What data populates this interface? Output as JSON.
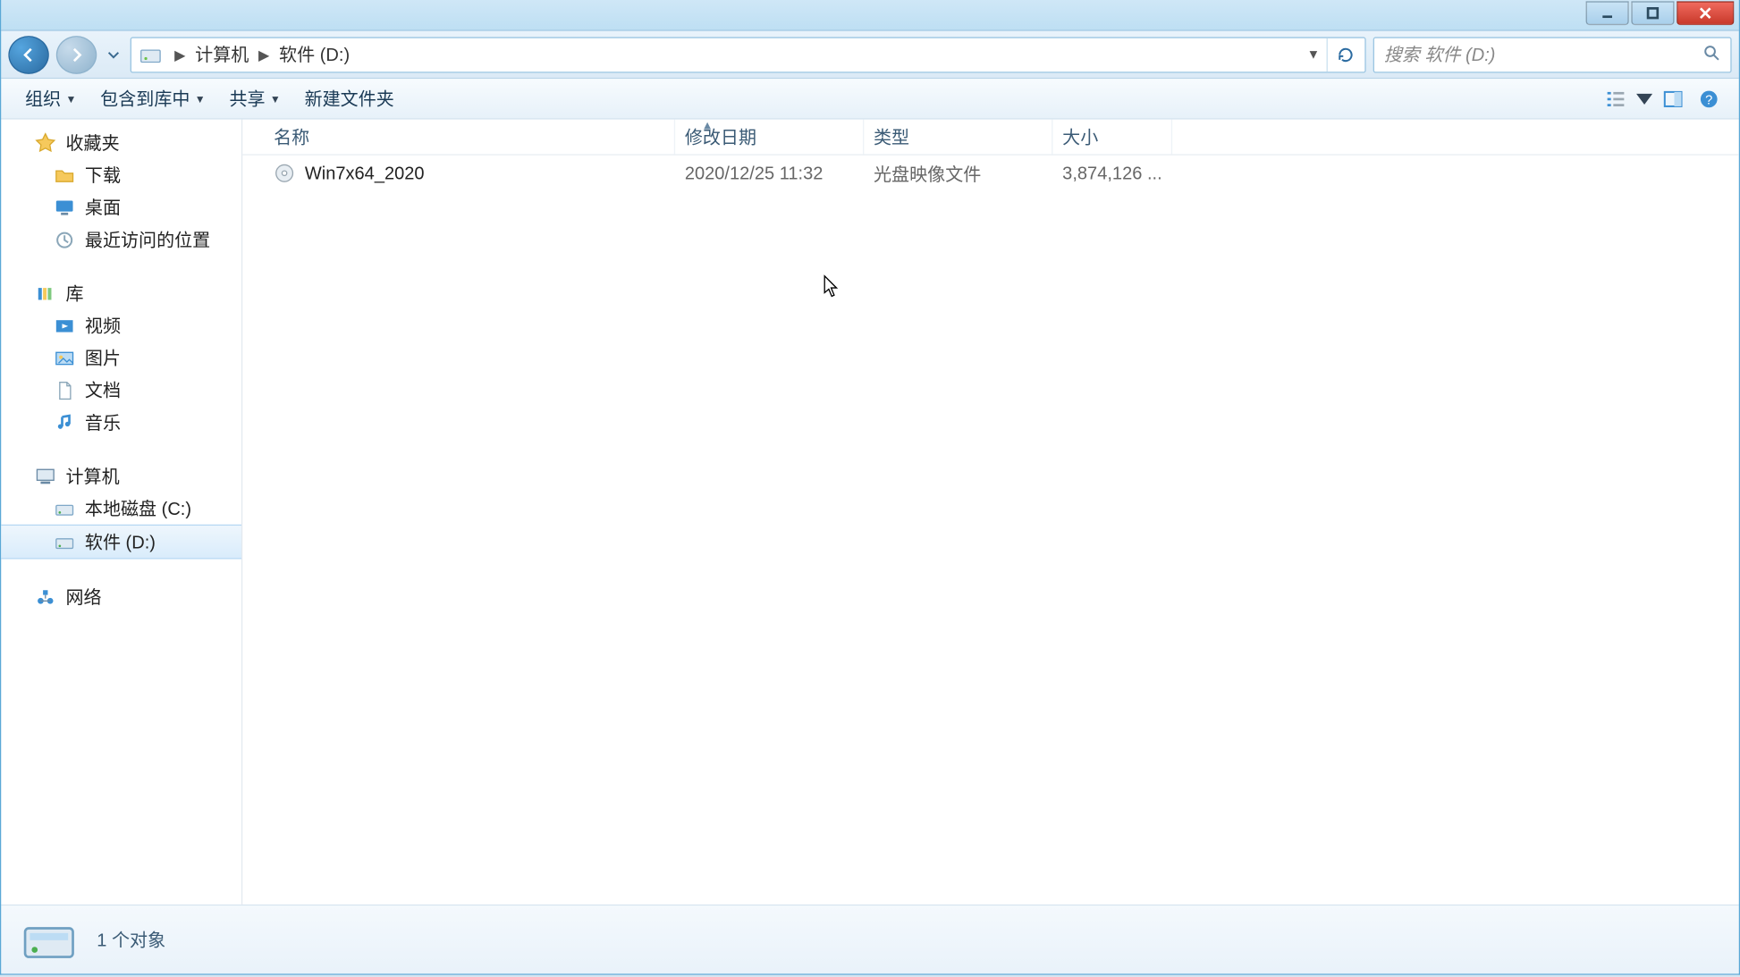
{
  "breadcrumbs": {
    "computer": "计算机",
    "drive": "软件 (D:)"
  },
  "search_placeholder": "搜索 软件 (D:)",
  "toolbar": {
    "organize": "组织",
    "include": "包含到库中",
    "share": "共享",
    "newfolder": "新建文件夹"
  },
  "columns": {
    "name": "名称",
    "date": "修改日期",
    "type": "类型",
    "size": "大小"
  },
  "files": [
    {
      "name": "Win7x64_2020",
      "date": "2020/12/25 11:32",
      "type": "光盘映像文件",
      "size": "3,874,126 ..."
    }
  ],
  "sidebar": {
    "fav": {
      "head": "收藏夹",
      "items": [
        "下载",
        "桌面",
        "最近访问的位置"
      ]
    },
    "lib": {
      "head": "库",
      "items": [
        "视频",
        "图片",
        "文档",
        "音乐"
      ]
    },
    "comp": {
      "head": "计算机",
      "items": [
        "本地磁盘 (C:)",
        "软件 (D:)"
      ]
    },
    "net": {
      "head": "网络"
    }
  },
  "status": {
    "count": "1 个对象"
  }
}
